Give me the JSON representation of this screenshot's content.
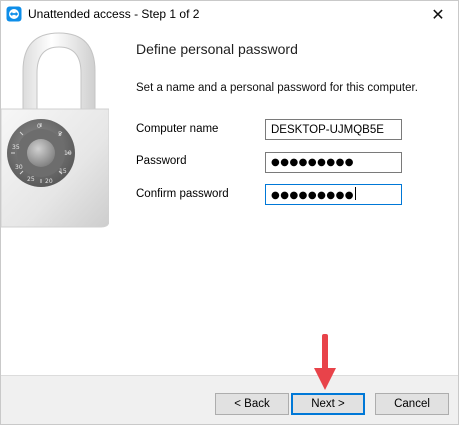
{
  "window": {
    "title": "Unattended access - Step 1 of 2",
    "close_glyph": "✕"
  },
  "main": {
    "heading": "Define personal password",
    "description": "Set a name and a personal password for this computer.",
    "fields": {
      "computer_name": {
        "label": "Computer name",
        "value": "DESKTOP-UJMQB5E"
      },
      "password": {
        "label": "Password",
        "value": "●●●●●●●●●"
      },
      "confirm_password": {
        "label": "Confirm password",
        "value": "●●●●●●●●●"
      }
    },
    "dial_numbers": [
      "0",
      "5",
      "10",
      "15",
      "20",
      "25",
      "30",
      "35"
    ]
  },
  "footer": {
    "back_label": "< Back",
    "next_label": "Next >",
    "cancel_label": "Cancel"
  },
  "colors": {
    "accent": "#0078d7",
    "arrow": "#e8434a",
    "footer_bg": "#f0f0f0"
  }
}
